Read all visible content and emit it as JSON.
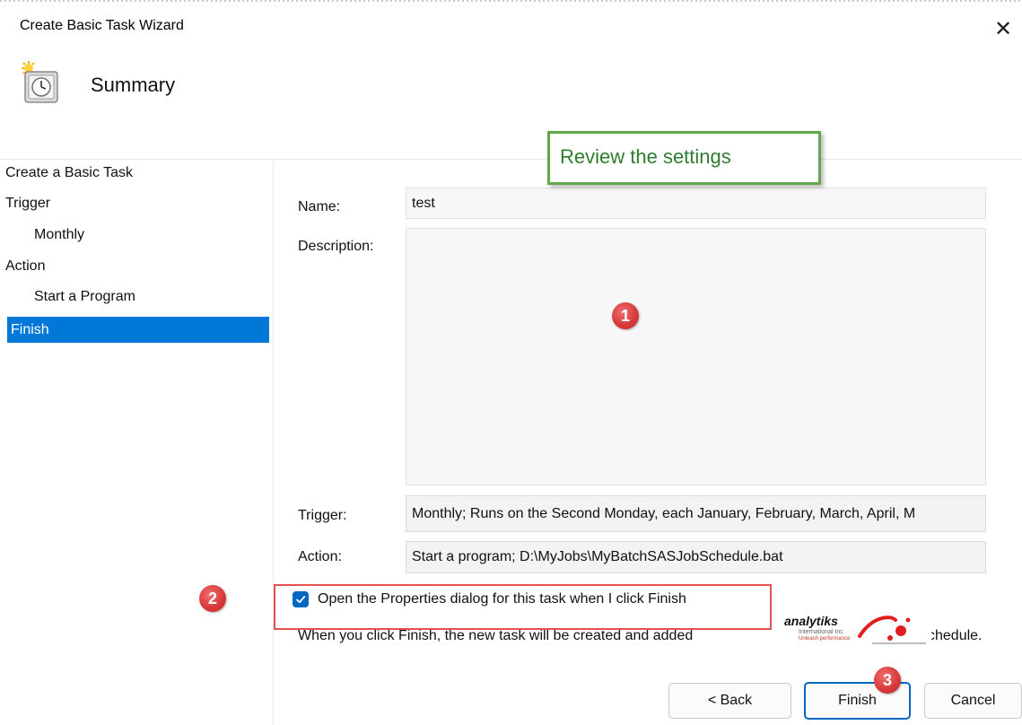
{
  "window": {
    "title": "Create Basic Task Wizard",
    "close_glyph": "✕",
    "header_title": "Summary",
    "header_icon": "scheduled-task-clock-icon"
  },
  "sidebar": {
    "items": [
      {
        "label": "Create a Basic Task",
        "indent": false,
        "selected": false
      },
      {
        "label": "Trigger",
        "indent": false,
        "selected": false
      },
      {
        "label": "Monthly",
        "indent": true,
        "selected": false
      },
      {
        "label": "Action",
        "indent": false,
        "selected": false
      },
      {
        "label": "Start a Program",
        "indent": true,
        "selected": false
      },
      {
        "label": "Finish",
        "indent": false,
        "selected": true
      }
    ]
  },
  "summary": {
    "name_label": "Name:",
    "name_value": "test",
    "description_label": "Description:",
    "description_value": "",
    "trigger_label": "Trigger:",
    "trigger_value": "Monthly; Runs on the Second Monday, each January, February, March, April, M",
    "action_label": "Action:",
    "action_value": "Start a program; D:\\MyJobs\\MyBatchSASJobSchedule.bat"
  },
  "options": {
    "open_properties_checked": true,
    "open_properties_label": "Open the Properties dialog for this task when I click Finish",
    "info_text": "When you click Finish, the new task will be created and added",
    "info_text_tail": "chedule."
  },
  "buttons": {
    "back": "< Back",
    "finish": "Finish",
    "cancel": "Cancel"
  },
  "annotations": {
    "callout_text": "Review the settings",
    "marker_1": "1",
    "marker_2": "2",
    "marker_3": "3",
    "callout_border_color": "#62a84a",
    "marker_color": "#d93b3b"
  },
  "watermark": {
    "logo_name": "analytiks",
    "logo_sub": "International Inc",
    "logo_tagline": "Unleash performance"
  },
  "colors": {
    "selection": "#0078d7",
    "checkbox": "#0067c0",
    "field_bg": "#f3f3f3"
  }
}
